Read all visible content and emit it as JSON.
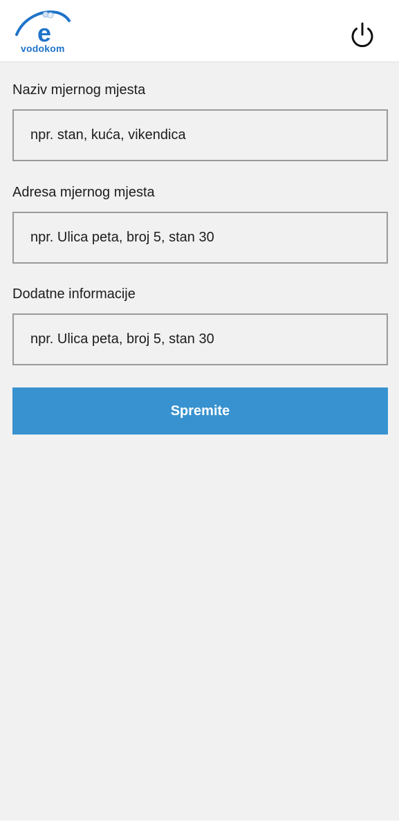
{
  "header": {
    "logo_text": "vodokom",
    "logo_letter": "e",
    "icons": {
      "logo": "vodokom-logo",
      "power": "power-icon"
    }
  },
  "form": {
    "fields": [
      {
        "label": "Naziv mjernog mjesta",
        "placeholder": "npr. stan, kuća, vikendica",
        "value": ""
      },
      {
        "label": "Adresa mjernog mjesta",
        "placeholder": "npr. Ulica peta, broj 5, stan 30",
        "value": ""
      },
      {
        "label": "Dodatne informacije",
        "placeholder": "npr. Ulica peta, broj 5, stan 30",
        "value": ""
      }
    ],
    "save_label": "Spremite"
  },
  "colors": {
    "brand_blue": "#1f73c9",
    "button_blue": "#3892cf",
    "background": "#f1f1f1",
    "header_background": "#ffffff"
  }
}
